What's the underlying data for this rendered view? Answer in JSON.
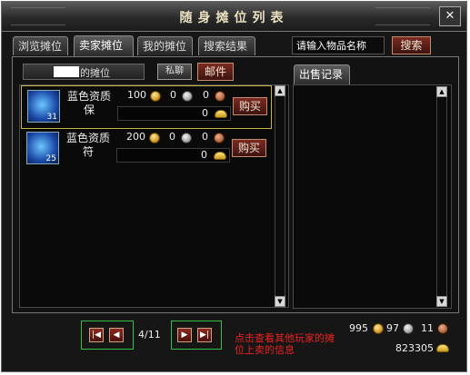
{
  "window": {
    "title": "随身摊位列表",
    "close_label": "✕"
  },
  "tabs": [
    {
      "label": "浏览摊位",
      "active": false
    },
    {
      "label": "卖家摊位",
      "active": true
    },
    {
      "label": "我的摊位",
      "active": false
    },
    {
      "label": "搜索结果",
      "active": false
    }
  ],
  "search": {
    "placeholder": "请输入物品名称",
    "button_label": "搜索"
  },
  "stall": {
    "owner_suffix": "的摊位",
    "whisper_label": "私聊",
    "mail_label": "邮件"
  },
  "items": [
    {
      "name": "蓝色资质保",
      "quantity": "31",
      "gold": "100",
      "silver": "0",
      "copper": "0",
      "ingot": "0",
      "buy_label": "购买",
      "selected": true
    },
    {
      "name": "蓝色资质符",
      "quantity": "25",
      "gold": "200",
      "silver": "0",
      "copper": "0",
      "ingot": "0",
      "buy_label": "购买",
      "selected": false
    }
  ],
  "sales_log": {
    "tab_label": "出售记录"
  },
  "pager": {
    "page_text": "4/11"
  },
  "hint_text": "点击查看其他玩家的摊位上卖的信息",
  "wallet": {
    "gold": "995",
    "silver": "97",
    "copper": "11",
    "ingot": "823305"
  },
  "colors": {
    "accent_gold": "#c8b24a",
    "nav_highlight": "#34c046",
    "hint_red": "#ee2222",
    "button_red": "#7a2b22"
  }
}
